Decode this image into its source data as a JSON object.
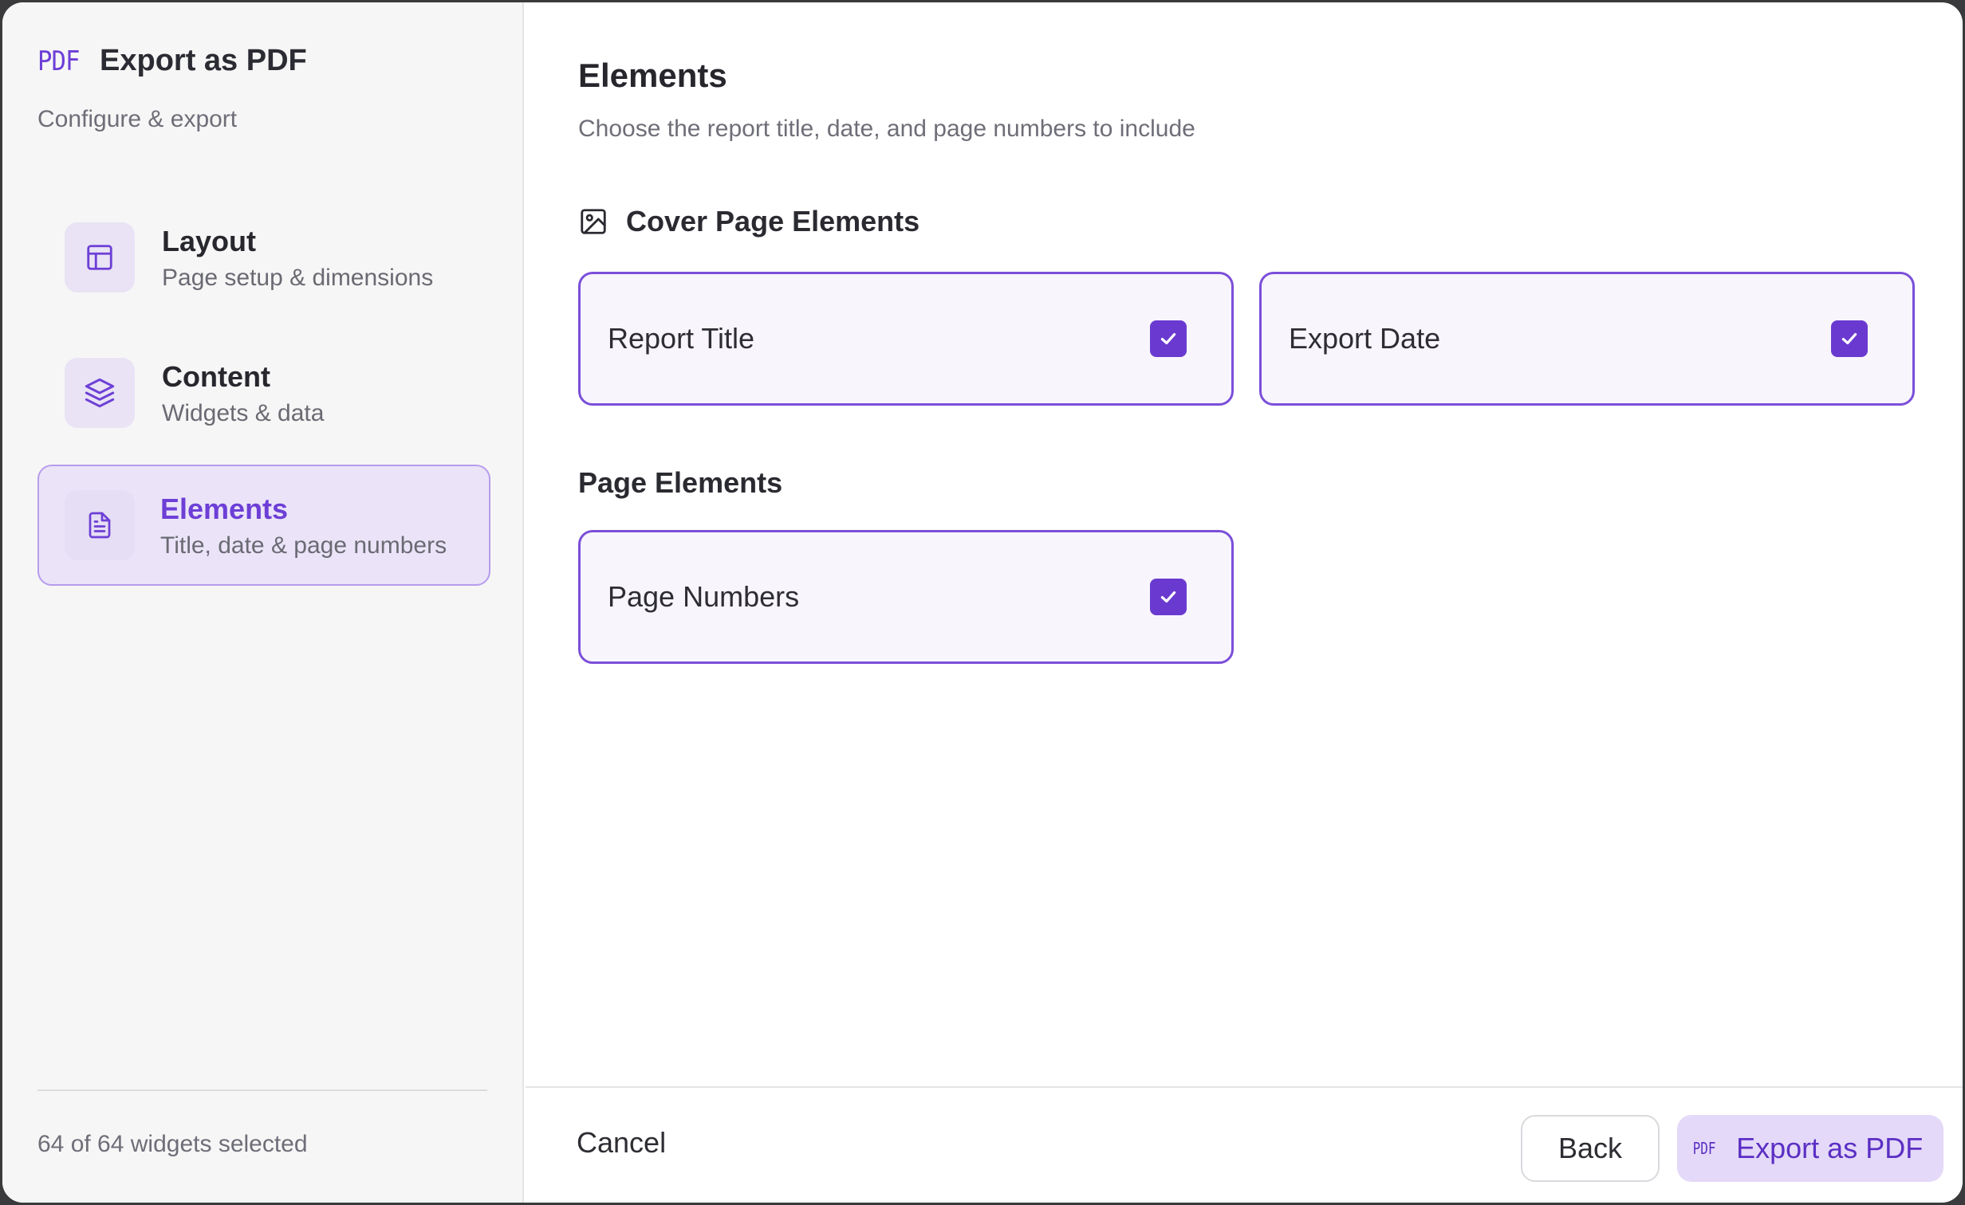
{
  "brand": {
    "logo": "PDF",
    "title": "Export as PDF",
    "subtitle": "Configure & export"
  },
  "sidebar": {
    "items": [
      {
        "title": "Layout",
        "desc": "Page setup & dimensions",
        "icon": "layout-icon",
        "active": false
      },
      {
        "title": "Content",
        "desc": "Widgets & data",
        "icon": "layers-icon",
        "active": false
      },
      {
        "title": "Elements",
        "desc": "Title, date & page numbers",
        "icon": "document-icon",
        "active": true
      }
    ],
    "footer": "64 of 64 widgets selected"
  },
  "main": {
    "title": "Elements",
    "subtitle": "Choose the report title, date, and page numbers to include",
    "cover_section": {
      "title": "Cover Page Elements",
      "icon": "image-icon",
      "options": [
        {
          "label": "Report Title",
          "checked": true
        },
        {
          "label": "Export Date",
          "checked": true
        }
      ]
    },
    "page_section": {
      "title": "Page Elements",
      "options": [
        {
          "label": "Page Numbers",
          "checked": true
        }
      ]
    }
  },
  "footer": {
    "cancel": "Cancel",
    "back": "Back",
    "export": "Export as PDF",
    "export_icon": "PDF"
  },
  "colors": {
    "accent": "#6a3ad0",
    "accent_light": "#e4d9f8",
    "active_bg": "#ebe4f8"
  }
}
